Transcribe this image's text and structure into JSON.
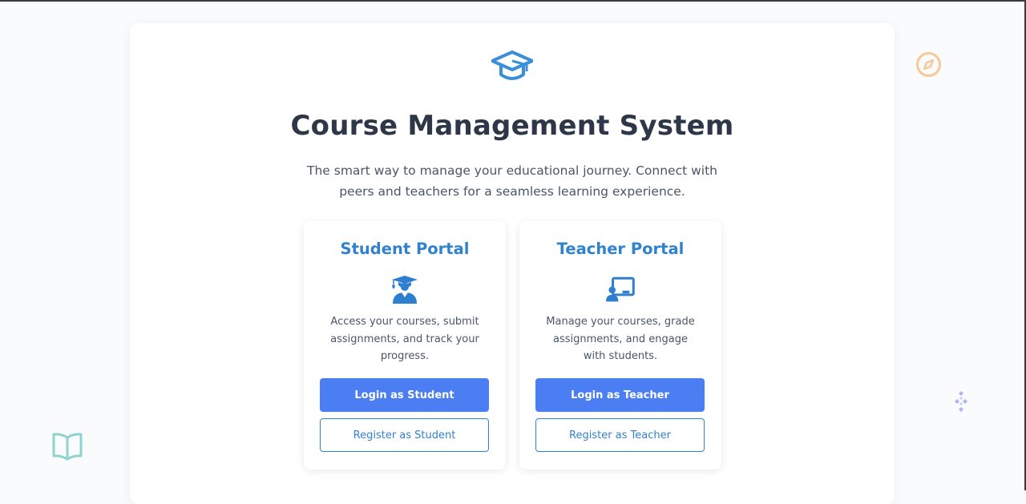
{
  "header": {
    "title": "Course Management System",
    "subtitle": "The smart way to manage your educational journey. Connect with peers and teachers for a seamless learning experience."
  },
  "portals": {
    "student": {
      "title": "Student Portal",
      "icon": "student-graduate-icon",
      "description": "Access your courses, submit assignments, and track your progress.",
      "login_label": "Login as Student",
      "register_label": "Register as Student"
    },
    "teacher": {
      "title": "Teacher Portal",
      "icon": "teacher-board-icon",
      "description": "Manage your courses, grade assignments, and engage with students.",
      "login_label": "Login as Teacher",
      "register_label": "Register as Teacher"
    }
  },
  "decorations": {
    "logo_icon": "graduation-cap-icon",
    "compass_icon": "compass-icon",
    "book_icon": "open-book-icon",
    "diamonds_icon": "diamond-cluster-icon"
  },
  "colors": {
    "accent": "#3182ce",
    "button_primary": "#4c7ef3",
    "heading": "#2d3748",
    "body_text": "#4a5568",
    "compass": "#f6c89a",
    "book": "#8fd3cf",
    "diamonds": "#a9b8f0"
  }
}
